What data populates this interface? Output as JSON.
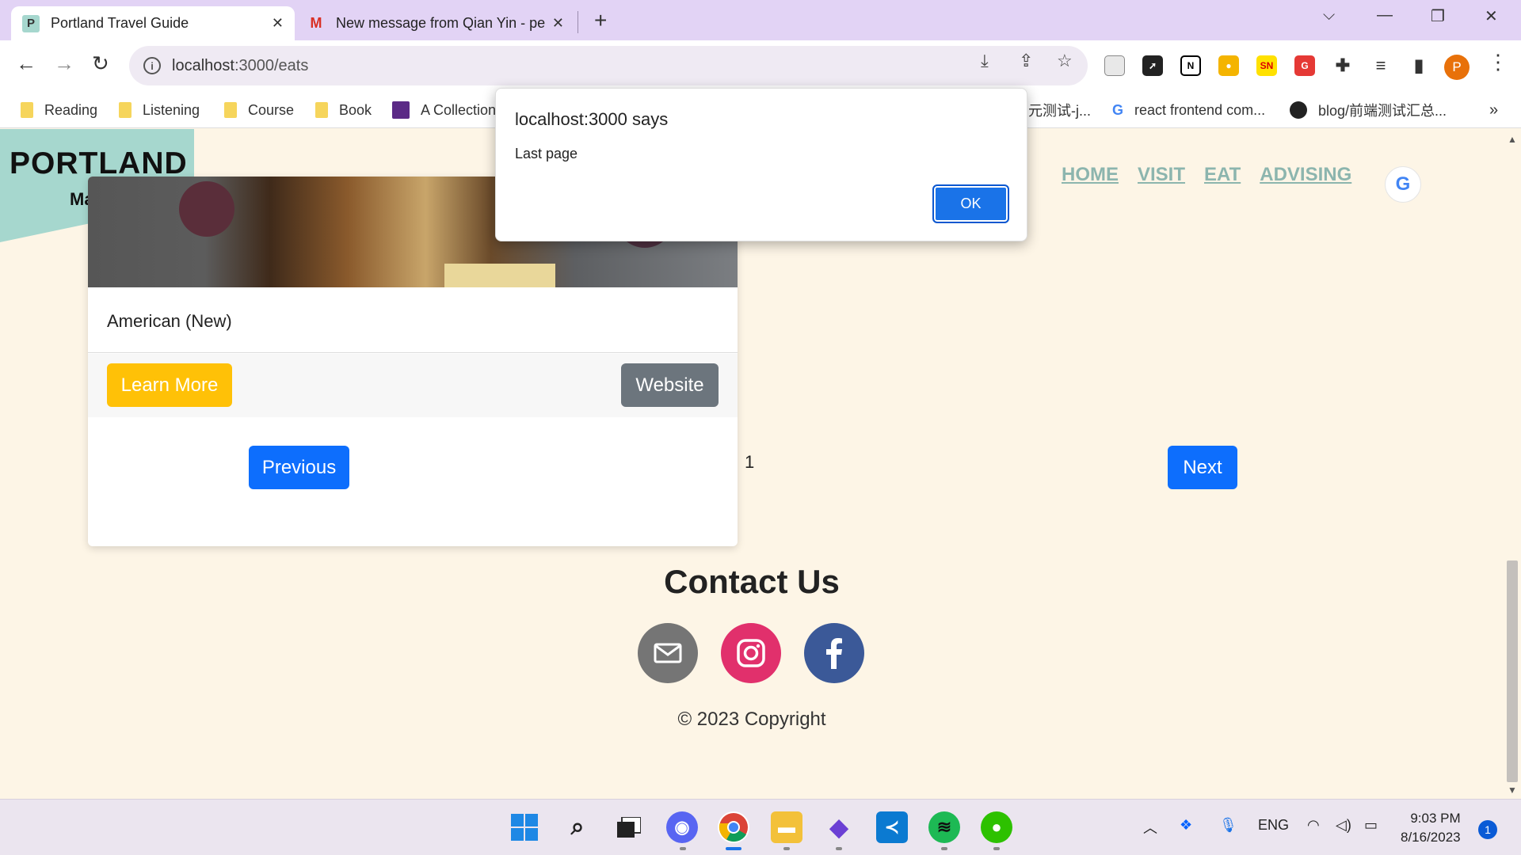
{
  "browser": {
    "tabs": [
      {
        "title": "Portland Travel Guide",
        "favicon": "P"
      },
      {
        "title": "New message from Qian Yin - pe",
        "favicon": "M"
      }
    ],
    "url_host": "localhost",
    "url_rest": ":3000/eats",
    "profile_initial": "P",
    "bookmarks": [
      "Reading",
      "Listening",
      "Course",
      "Book",
      "A Collection",
      "元测试-j...",
      "react frontend com...",
      "blog/前端测试汇总..."
    ]
  },
  "site": {
    "logo_title": "PORTLAND",
    "logo_subtitle": "Maine",
    "nav": [
      "HOME",
      "VISIT",
      "EAT",
      "ADVISING"
    ],
    "google_letter": "G"
  },
  "card": {
    "cuisine": "American (New)",
    "learn_more": "Learn More",
    "website": "Website"
  },
  "pagination": {
    "previous": "Previous",
    "page": "1",
    "next": "Next"
  },
  "footer": {
    "contact_title": "Contact Us",
    "copyright": "© 2023 Copyright"
  },
  "dialog": {
    "origin": "localhost:3000 says",
    "message": "Last page",
    "ok": "OK"
  },
  "taskbar": {
    "language": "ENG",
    "time": "9:03 PM",
    "date": "8/16/2023",
    "notifications": "1"
  },
  "colors": {
    "page_bg": "#fdf5e6",
    "logo_bg": "#a6d7ce",
    "nav_link": "#8cb5ae",
    "primary": "#0d6efd",
    "warning": "#ffc107",
    "secondary": "#6c757d"
  }
}
